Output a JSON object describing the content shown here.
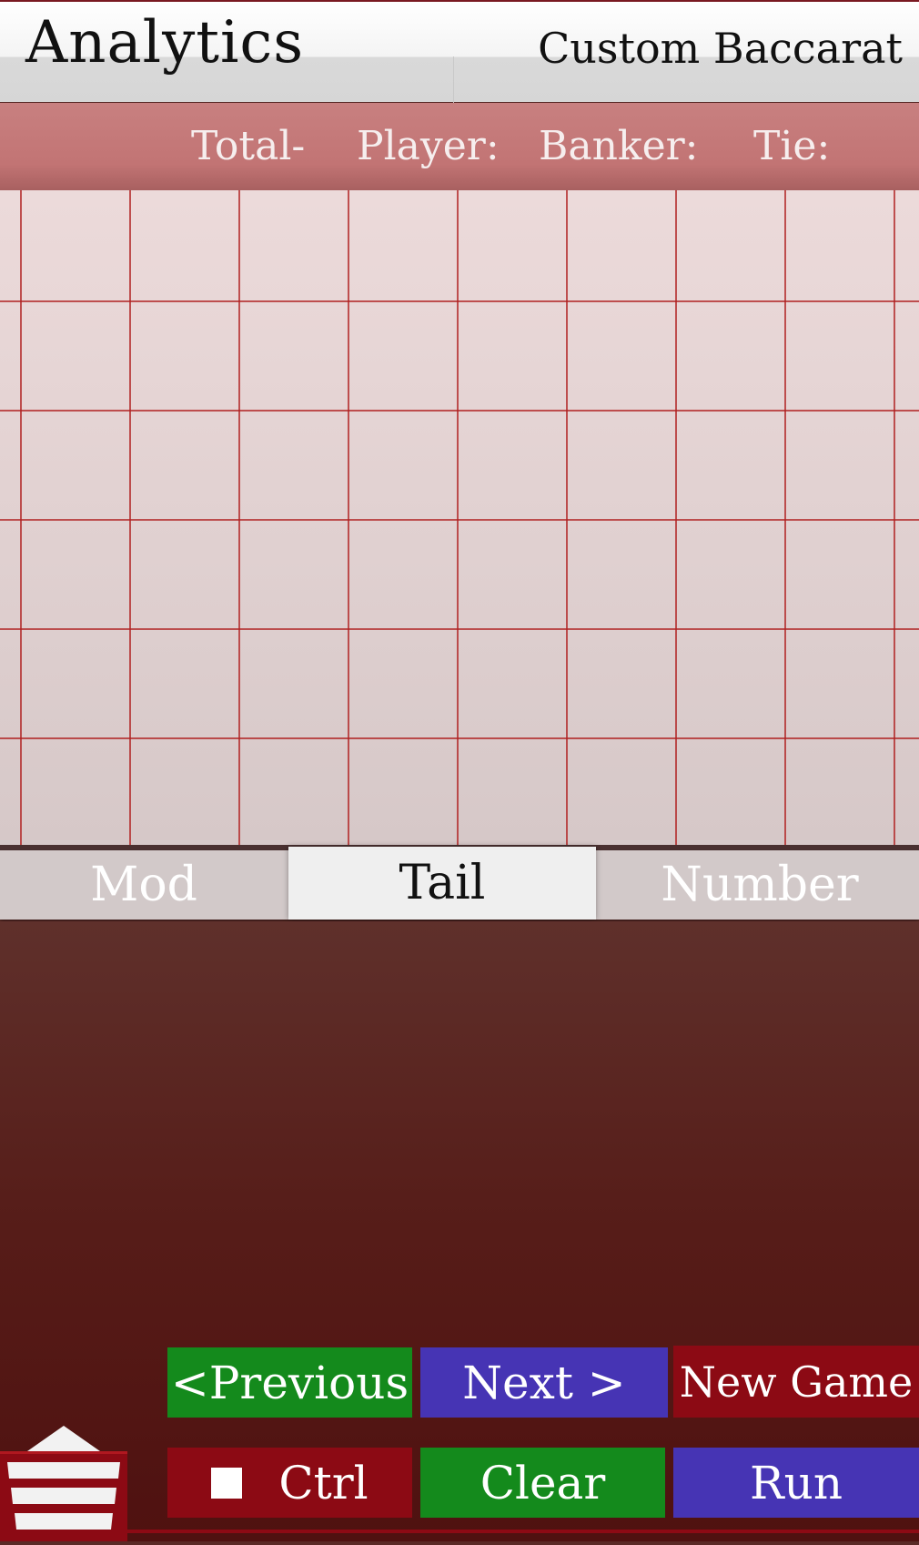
{
  "header": {
    "title": "Analytics",
    "subtitle": "Custom Baccarat"
  },
  "stats": {
    "total_label": "Total-",
    "player_label": "Player:",
    "banker_label": "Banker:",
    "tie_label": "Tie:"
  },
  "tabs": [
    {
      "label": "Mod",
      "active": false
    },
    {
      "label": "Tail",
      "active": true
    },
    {
      "label": "Number",
      "active": false
    }
  ],
  "controls": {
    "previous_label": "<Previous",
    "next_label": "Next >",
    "new_game_label": "New Game",
    "ctrl_label": "Ctrl",
    "clear_label": "Clear",
    "run_label": "Run"
  },
  "icons": {
    "menu": "menu-icon",
    "ctrl_checkbox": "checkbox-icon"
  },
  "colors": {
    "accent_red": "#8c0a14",
    "green": "#148a1c",
    "blue": "#4634b4",
    "grid_line": "#b02020"
  }
}
